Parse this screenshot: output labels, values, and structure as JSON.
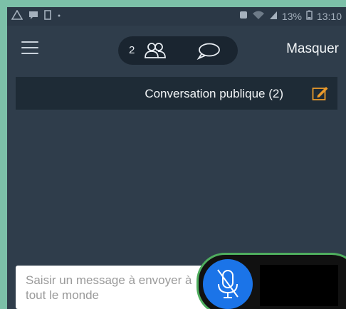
{
  "status_bar": {
    "left_icons": [
      "warning-icon",
      "message-icon",
      "sim-icon"
    ],
    "right_icons": [
      "notification-icon",
      "wifi-icon",
      "signal-icon",
      "battery-icon"
    ],
    "battery": "13%",
    "time": "13:10"
  },
  "app_bar": {
    "participant_count": "2",
    "hide_label": "Masquer"
  },
  "conversation": {
    "title": "Conversation publique (2)"
  },
  "composer": {
    "placeholder": "Saisir un message à envoyer à tout le monde"
  },
  "colors": {
    "accent_orange": "#e99a2b",
    "mic_blue": "#1b74e8",
    "mic_ring_green": "#4fae5e"
  }
}
